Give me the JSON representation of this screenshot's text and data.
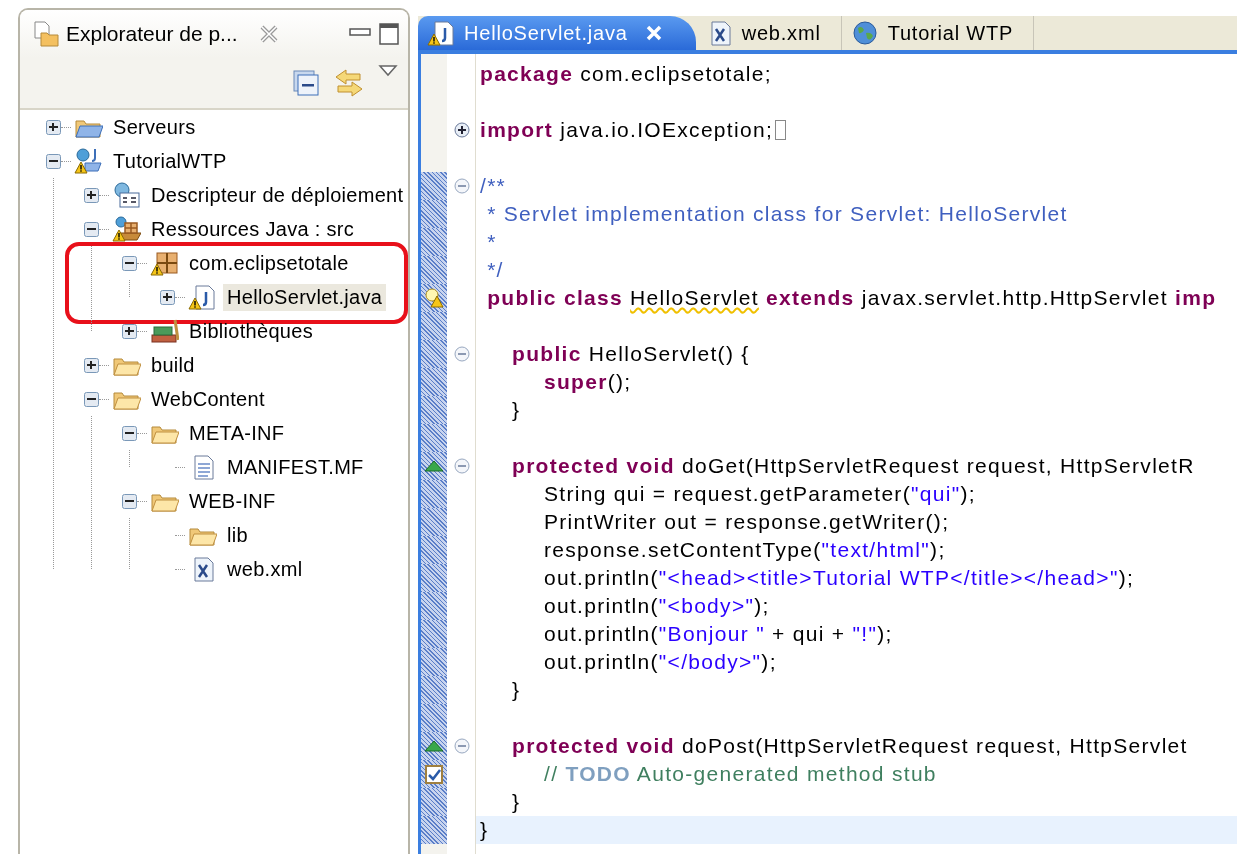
{
  "explorer": {
    "title": "Explorateur de p...",
    "tree": [
      {
        "label": "Serveurs",
        "kind": "servers",
        "expanded": false
      },
      {
        "label": "TutorialWTP",
        "kind": "project",
        "warning": true,
        "expanded": true,
        "children": [
          {
            "label": "Descripteur de déploiement",
            "kind": "descriptor",
            "expanded": false
          },
          {
            "label": "Ressources Java : src",
            "kind": "resources",
            "warning": true,
            "expanded": true,
            "children": [
              {
                "label": "com.eclipsetotale",
                "kind": "package",
                "warning": true,
                "expanded": true,
                "children": [
                  {
                    "label": "HelloServlet.java",
                    "kind": "java",
                    "warning": true,
                    "expanded": false,
                    "selected": true
                  }
                ]
              },
              {
                "label": "Bibliothèques",
                "kind": "library",
                "expanded": false,
                "selected": false
              }
            ]
          },
          {
            "label": "build",
            "kind": "folder",
            "expanded": false
          },
          {
            "label": "WebContent",
            "kind": "folder",
            "expanded": true,
            "children": [
              {
                "label": "META-INF",
                "kind": "folder",
                "expanded": true,
                "children": [
                  {
                    "label": "MANIFEST.MF",
                    "kind": "text"
                  }
                ]
              },
              {
                "label": "WEB-INF",
                "kind": "folder",
                "expanded": true,
                "children": [
                  {
                    "label": "lib",
                    "kind": "folder"
                  },
                  {
                    "label": "web.xml",
                    "kind": "xml"
                  }
                ]
              }
            ]
          }
        ]
      }
    ]
  },
  "editor": {
    "tabs": [
      {
        "label": "HelloServlet.java",
        "kind": "java",
        "selected": true
      },
      {
        "label": "web.xml",
        "kind": "xml",
        "selected": false
      },
      {
        "label": "Tutorial WTP",
        "kind": "globe",
        "selected": false
      }
    ],
    "lines": [
      {
        "kind": "code",
        "segments": [
          {
            "kind": "kw",
            "text": "package"
          },
          {
            "kind": "plain",
            "text": " com.eclipsetotale;"
          }
        ]
      },
      {
        "kind": "blank"
      },
      {
        "kind": "code",
        "fold_expanded": false,
        "segments": [
          {
            "kind": "kw",
            "text": "import"
          },
          {
            "kind": "plain",
            "text": " java.io.IOException;"
          }
        ]
      },
      {
        "kind": "blank"
      },
      {
        "kind": "code",
        "fold_expanded": true,
        "range": true,
        "segments": [
          {
            "kind": "javadoc",
            "text": "/**"
          }
        ]
      },
      {
        "kind": "code",
        "range": true,
        "segments": [
          {
            "kind": "javadoc",
            "text": " * Servlet implementation class for Servlet: HelloServlet"
          }
        ]
      },
      {
        "kind": "code",
        "range": true,
        "segments": [
          {
            "kind": "javadoc",
            "text": " *"
          }
        ]
      },
      {
        "kind": "code",
        "range": true,
        "segments": [
          {
            "kind": "javadoc",
            "text": " */"
          }
        ]
      },
      {
        "kind": "code",
        "range": true,
        "warning": true,
        "segments": [
          {
            "kind": "kw",
            "text": " public class "
          },
          {
            "kind": "warn",
            "text": "HelloServlet"
          },
          {
            "kind": "kw",
            "text": " extends"
          },
          {
            "kind": "plain",
            "text": " javax.servlet.http.HttpServlet "
          },
          {
            "kind": "kw",
            "text": "imp"
          }
        ]
      },
      {
        "kind": "blank",
        "range": true
      },
      {
        "kind": "code",
        "range": true,
        "fold_expanded": true,
        "segments": [
          {
            "kind": "kw",
            "text": "\tpublic"
          },
          {
            "kind": "plain",
            "text": " HelloServlet() {"
          }
        ]
      },
      {
        "kind": "code",
        "range": true,
        "segments": [
          {
            "kind": "kw",
            "text": "\t\tsuper"
          },
          {
            "kind": "plain",
            "text": "();"
          }
        ]
      },
      {
        "kind": "code",
        "range": true,
        "segments": [
          {
            "kind": "plain",
            "text": "\t}"
          }
        ]
      },
      {
        "kind": "blank",
        "range": true
      },
      {
        "kind": "code",
        "range": true,
        "fold_expanded": true,
        "override": true,
        "segments": [
          {
            "kind": "kw",
            "text": "\tprotected void"
          },
          {
            "kind": "plain",
            "text": " doGet(HttpServletRequest request, HttpServletR"
          }
        ]
      },
      {
        "kind": "code",
        "range": true,
        "segments": [
          {
            "kind": "plain",
            "text": "\t\tString qui = request.getParameter("
          },
          {
            "kind": "str",
            "text": "\"qui\""
          },
          {
            "kind": "plain",
            "text": ");"
          }
        ]
      },
      {
        "kind": "code",
        "range": true,
        "segments": [
          {
            "kind": "plain",
            "text": "\t\tPrintWriter out = response.getWriter();"
          }
        ]
      },
      {
        "kind": "code",
        "range": true,
        "segments": [
          {
            "kind": "plain",
            "text": "\t\tresponse.setContentType("
          },
          {
            "kind": "str",
            "text": "\"text/html\""
          },
          {
            "kind": "plain",
            "text": ");"
          }
        ]
      },
      {
        "kind": "code",
        "range": true,
        "segments": [
          {
            "kind": "plain",
            "text": "\t\tout.println("
          },
          {
            "kind": "str",
            "text": "\"<head><title>Tutorial WTP</title></head>\""
          },
          {
            "kind": "plain",
            "text": ");"
          }
        ]
      },
      {
        "kind": "code",
        "range": true,
        "segments": [
          {
            "kind": "plain",
            "text": "\t\tout.println("
          },
          {
            "kind": "str",
            "text": "\"<body>\""
          },
          {
            "kind": "plain",
            "text": ");"
          }
        ]
      },
      {
        "kind": "code",
        "range": true,
        "segments": [
          {
            "kind": "plain",
            "text": "\t\tout.println("
          },
          {
            "kind": "str",
            "text": "\"Bonjour \""
          },
          {
            "kind": "plain",
            "text": " + qui + "
          },
          {
            "kind": "str",
            "text": "\"!\""
          },
          {
            "kind": "plain",
            "text": ");"
          }
        ]
      },
      {
        "kind": "code",
        "range": true,
        "segments": [
          {
            "kind": "plain",
            "text": "\t\tout.println("
          },
          {
            "kind": "str",
            "text": "\"</body>\""
          },
          {
            "kind": "plain",
            "text": ");"
          }
        ]
      },
      {
        "kind": "code",
        "range": true,
        "segments": [
          {
            "kind": "plain",
            "text": "\t}"
          }
        ]
      },
      {
        "kind": "blank",
        "range": true
      },
      {
        "kind": "code",
        "range": true,
        "fold_expanded": true,
        "override": true,
        "segments": [
          {
            "kind": "kw",
            "text": "\tprotected void"
          },
          {
            "kind": "plain",
            "text": " doPost(HttpServletRequest request, HttpServlet"
          }
        ]
      },
      {
        "kind": "code",
        "range": true,
        "task": true,
        "segments": [
          {
            "kind": "comment",
            "text": "\t\t// "
          },
          {
            "kind": "todo",
            "text": "TODO"
          },
          {
            "kind": "comment",
            "text": " Auto-generated method stub"
          }
        ]
      },
      {
        "kind": "code",
        "range": true,
        "segments": [
          {
            "kind": "plain",
            "text": "\t}"
          }
        ]
      },
      {
        "kind": "code",
        "range": true,
        "current": true,
        "segments": [
          {
            "kind": "plain",
            "text": "}"
          }
        ]
      }
    ]
  }
}
